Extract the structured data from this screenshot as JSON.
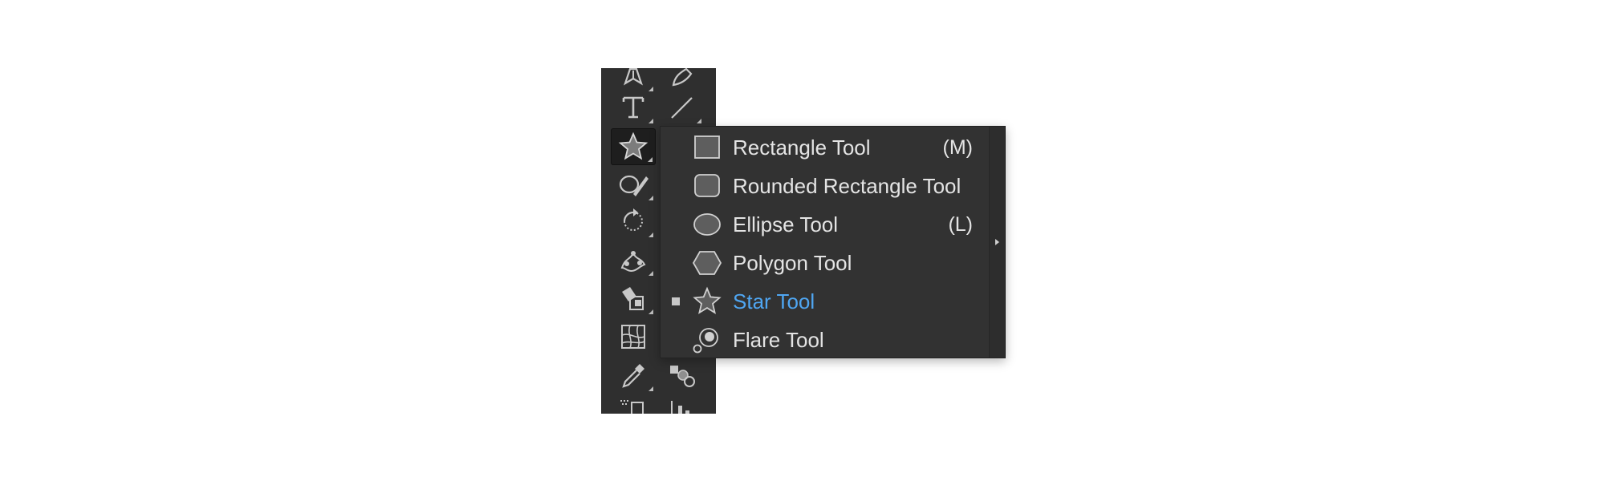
{
  "toolbar": {
    "tools": [
      {
        "name": "pen-tool-icon",
        "active": false
      },
      {
        "name": "curvature-tool-icon",
        "active": false
      },
      {
        "name": "type-tool-icon",
        "active": false
      },
      {
        "name": "line-segment-tool-icon",
        "active": false
      },
      {
        "name": "star-tool-icon",
        "active": true
      },
      {
        "name": "shaper-tool-icon",
        "active": false
      },
      {
        "name": "rotate-tool-icon",
        "active": false
      },
      {
        "name": "puppet-warp-tool-icon",
        "active": false
      },
      {
        "name": "live-paint-bucket-tool-icon",
        "active": false
      },
      {
        "name": "mesh-tool-icon",
        "active": false
      },
      {
        "name": "eyedropper-tool-icon",
        "active": false
      },
      {
        "name": "blend-tool-icon",
        "active": false
      },
      {
        "name": "symbol-sprayer-tool-icon",
        "active": false
      },
      {
        "name": "column-graph-tool-icon",
        "active": false
      }
    ]
  },
  "flyout": {
    "items": [
      {
        "id": "rectangle",
        "label": "Rectangle Tool",
        "shortcut": "(M)",
        "icon": "rectangle-icon",
        "selected": false
      },
      {
        "id": "rounded-rectangle",
        "label": "Rounded Rectangle Tool",
        "shortcut": "",
        "icon": "rounded-rectangle-icon",
        "selected": false
      },
      {
        "id": "ellipse",
        "label": "Ellipse Tool",
        "shortcut": "(L)",
        "icon": "ellipse-icon",
        "selected": false
      },
      {
        "id": "polygon",
        "label": "Polygon Tool",
        "shortcut": "",
        "icon": "hexagon-icon",
        "selected": false
      },
      {
        "id": "star",
        "label": "Star Tool",
        "shortcut": "",
        "icon": "star-icon",
        "selected": true
      },
      {
        "id": "flare",
        "label": "Flare Tool",
        "shortcut": "",
        "icon": "flare-icon",
        "selected": false
      }
    ]
  },
  "colors": {
    "panel": "#323232",
    "toolbar": "#2f2f2f",
    "selected_text": "#4fa6f2",
    "text": "#e4e4e4"
  }
}
